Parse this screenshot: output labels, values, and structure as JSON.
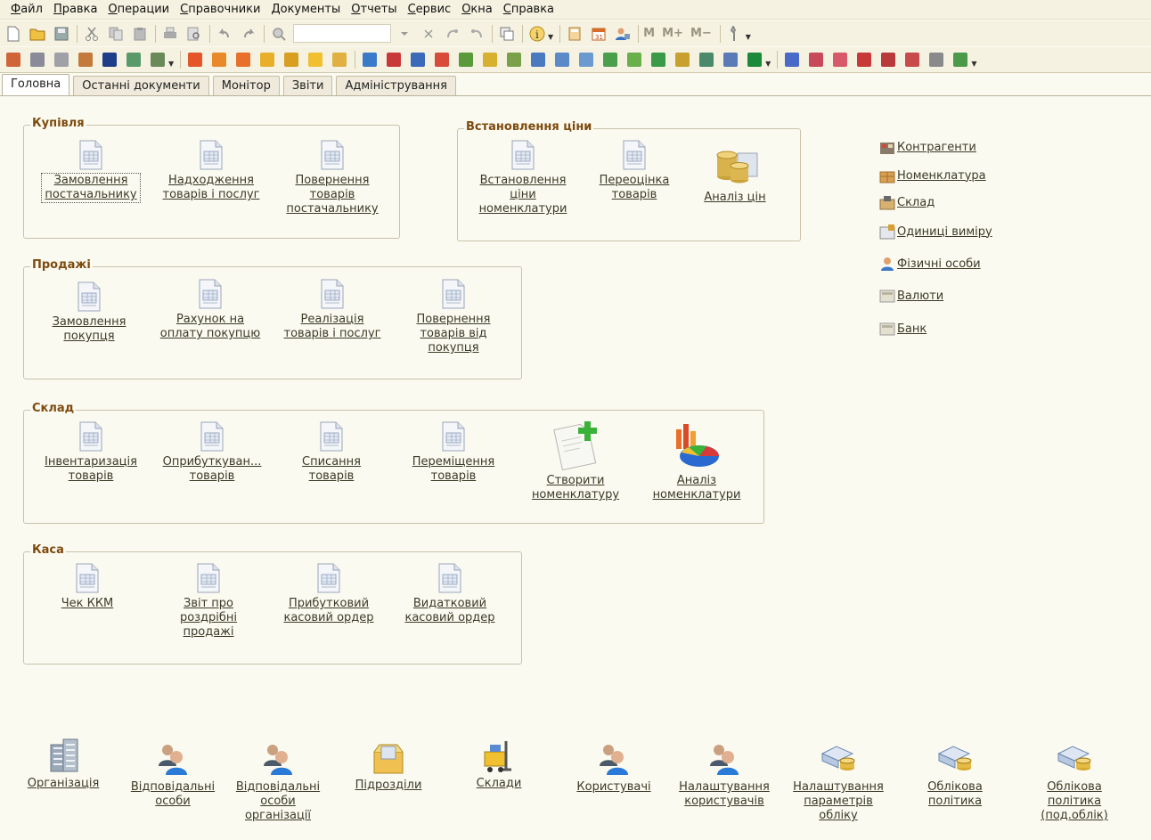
{
  "menu": [
    "Файл",
    "Правка",
    "Операции",
    "Справочники",
    "Документы",
    "Отчеты",
    "Сервис",
    "Окна",
    "Справка"
  ],
  "toolbar": {
    "m": "M",
    "m_plus": "M+",
    "m_minus": "M−"
  },
  "tabs": [
    "Головна",
    "Останні документи",
    "Монітор",
    "Звіти",
    "Адміністрування"
  ],
  "groups": {
    "purchase": {
      "title": "Купівля",
      "items": [
        "Замовлення\nпостачальнику",
        "Надходження\nтоварів і послуг",
        "Повернення\nтоварів\nпостачальнику"
      ]
    },
    "pricing": {
      "title": "Встановлення ціни",
      "items": [
        "Встановлення\nціни\nноменклатури",
        "Переоцінка\nтоварів",
        "Аналіз цін"
      ]
    },
    "sales": {
      "title": "Продажі",
      "items": [
        "Замовлення\nпокупця",
        "Рахунок на\nоплату покупцю",
        "Реалізація\nтоварів і послуг",
        "Повернення\nтоварів від\nпокупця"
      ]
    },
    "warehouse": {
      "title": "Склад",
      "items": [
        "Інвентаризація\nтоварів",
        "Оприбуткуван...\nтоварів",
        "Списання\nтоварів",
        "Переміщення\nтоварів",
        "Створити\nноменклатуру",
        "Аналіз\nноменклатури"
      ]
    },
    "cash": {
      "title": "Каса",
      "items": [
        "Чек ККМ",
        "Звіт про\nроздрібні\nпродажі",
        "Прибутковий\nкасовий ордер",
        "Видатковий\nкасовий ордер"
      ]
    }
  },
  "right_links": [
    "Контрагенти",
    "Номенклатура",
    "Склад",
    "Одиниці виміру",
    "Фізичні особи",
    "Валюти",
    "Банк"
  ],
  "bottom": [
    "Організація",
    "Відповідальні\nособи",
    "Відповідальні\nособи\nорганізації",
    "Підрозділи",
    "Склади",
    "Користувачі",
    "Налаштування\nкористувачів",
    "Налаштування\nпараметрів\nобліку",
    "Облікова\nполітика",
    "Облікова\nполітика\n(под.облік)"
  ],
  "colors": {
    "accent": "#7d4b0e",
    "background": "#fbfaf1",
    "link": "#3c3a26"
  }
}
